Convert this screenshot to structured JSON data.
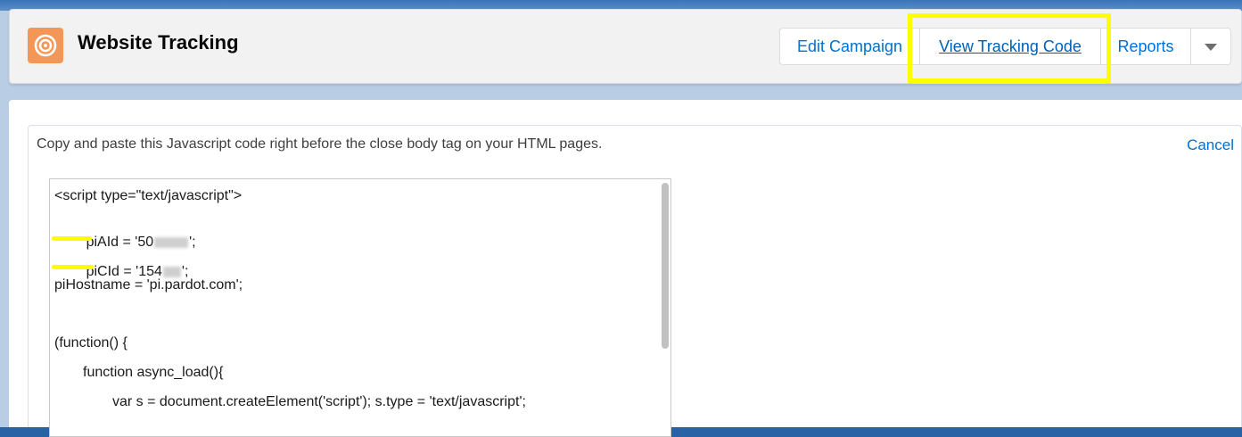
{
  "header": {
    "title": "Website Tracking",
    "icon": "target-icon",
    "accent_color": "#f49756",
    "buttons": {
      "edit": "Edit Campaign",
      "view_tracking": "View Tracking Code",
      "reports": "Reports"
    },
    "menu_icon": "chevron-down-icon",
    "highlight_color": "#ffff00"
  },
  "panel": {
    "instructions": "Copy and paste this Javascript code right before the close body tag on your HTML pages.",
    "cancel": "Cancel"
  },
  "code": {
    "line1": "<script type=\"text/javascript\">",
    "line2_pre": "piAId = '50",
    "line2_post": "';",
    "line3_pre": "piCId = '154",
    "line3_post": "';",
    "line4": "piHostname = 'pi.pardot.com';",
    "line6": "(function() {",
    "line7": "function async_load(){",
    "line8": "var s = document.createElement('script'); s.type = 'text/javascript';"
  }
}
